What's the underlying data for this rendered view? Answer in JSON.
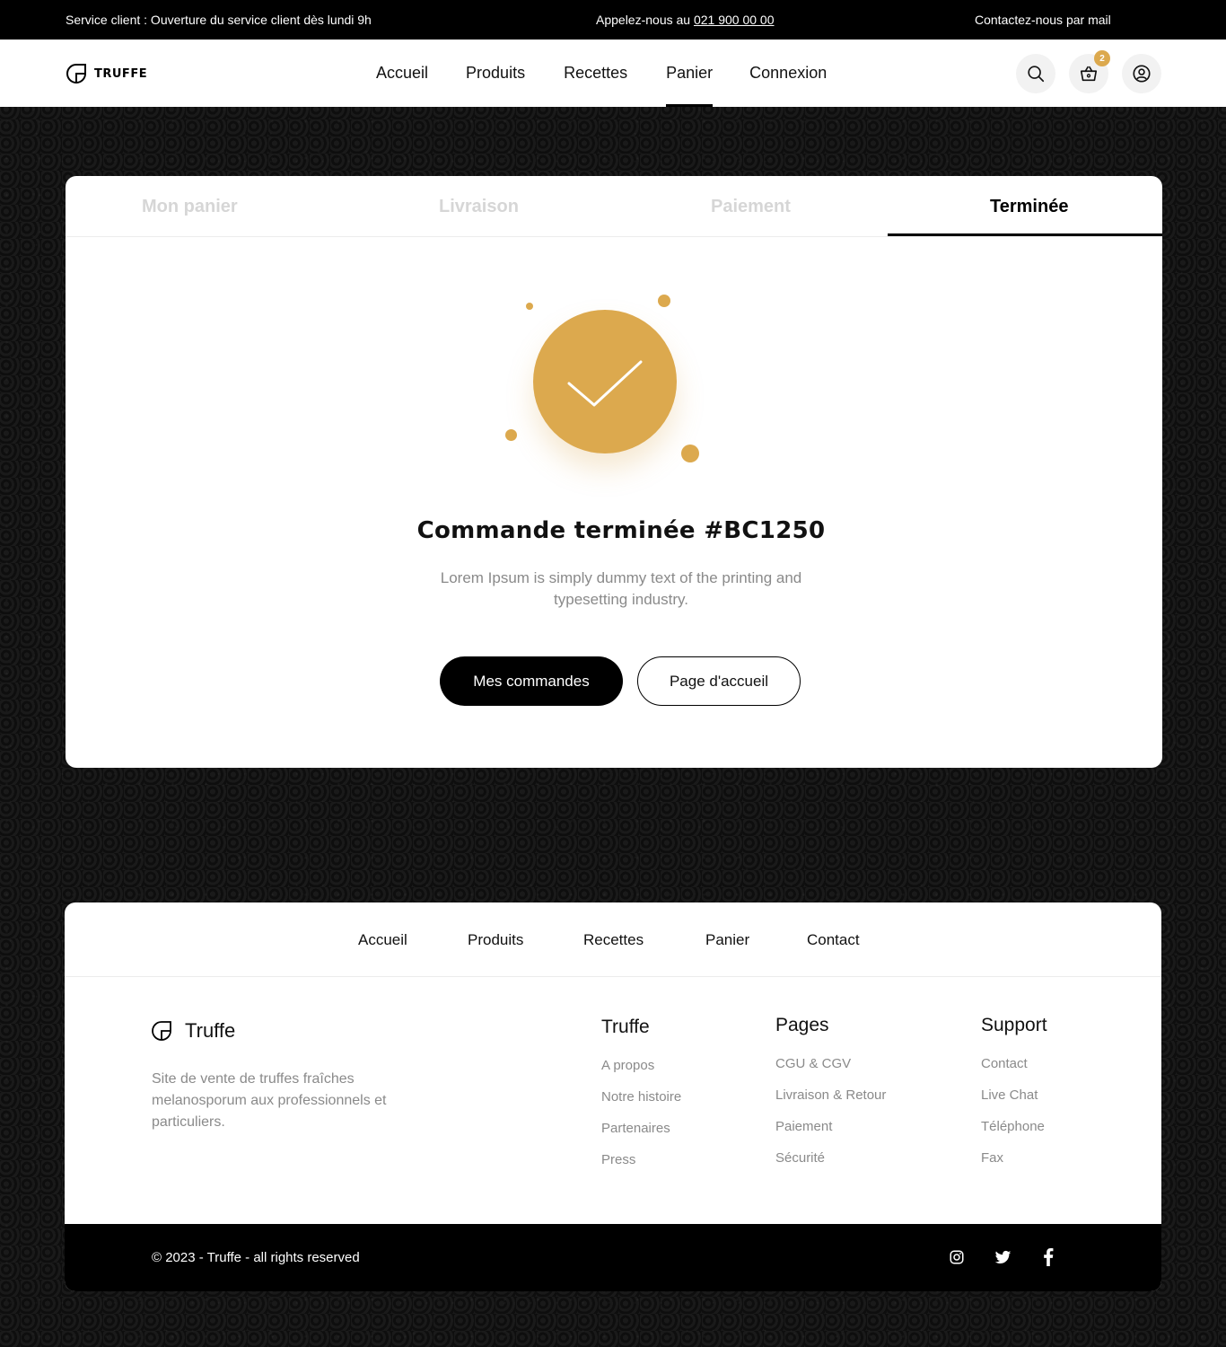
{
  "topbar": {
    "left_text": "Service client : Ouverture du service client dès lundi 9h",
    "call_prefix": "Appelez-nous au",
    "phone": "021 900 00 00",
    "right_text": "Contactez-nous par mail"
  },
  "header": {
    "logo_text": "TRUFFE",
    "nav": [
      "Accueil",
      "Produits",
      "Recettes",
      "Panier",
      "Connexion"
    ],
    "active_nav": "Panier",
    "cart_count": "2",
    "icons": [
      "search-icon",
      "basket-icon",
      "user-icon"
    ]
  },
  "checkout": {
    "steps": [
      "Mon panier",
      "Livraison",
      "Paiement",
      "Terminée"
    ],
    "active_step": "Terminée",
    "title": "Commande terminée #BC1250",
    "description": "Lorem Ipsum is simply dummy text of the printing and typesetting industry.",
    "primary_button": "Mes commandes",
    "secondary_button": "Page d'accueil",
    "accent_color": "#dca94e"
  },
  "footer": {
    "nav": [
      "Accueil",
      "Produits",
      "Recettes",
      "Panier",
      "Contact"
    ],
    "brand": "Truffe",
    "description": "Site de vente de truffes fraîches melanosporum aux professionnels et particuliers.",
    "columns": [
      {
        "title": "Truffe",
        "links": [
          "A propos",
          "Notre histoire",
          "Partenaires",
          "Press"
        ]
      },
      {
        "title": "Pages",
        "links": [
          "CGU & CGV",
          "Livraison & Retour",
          "Paiement",
          "Sécurité"
        ]
      },
      {
        "title": "Support",
        "links": [
          "Contact",
          "Live Chat",
          "Téléphone",
          "Fax"
        ]
      }
    ],
    "copyright": "© 2023 - Truffe - all rights reserved",
    "social_icons": [
      "instagram-icon",
      "twitter-icon",
      "facebook-icon"
    ]
  }
}
